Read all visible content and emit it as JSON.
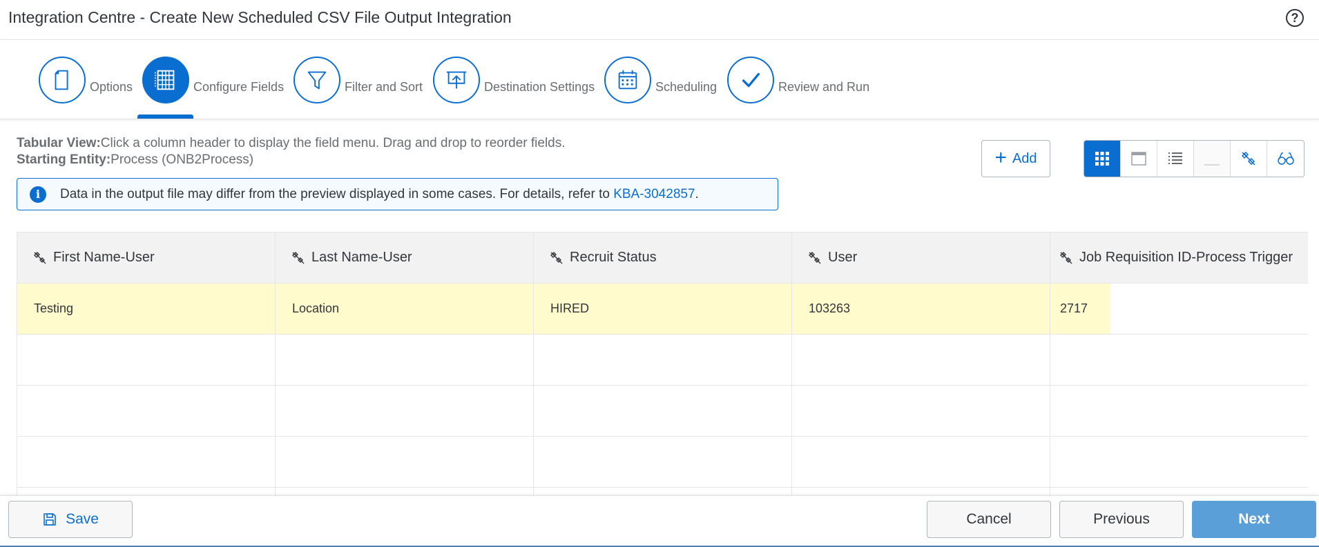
{
  "header": {
    "title": "Integration Centre - Create New Scheduled CSV File Output Integration",
    "help_icon": "question-circle-icon",
    "help_glyph": "?"
  },
  "wizard": {
    "steps": [
      {
        "label": "Options",
        "icon": "document-icon",
        "active": false
      },
      {
        "label": "Configure Fields",
        "icon": "table-grid-icon",
        "active": true
      },
      {
        "label": "Filter and Sort",
        "icon": "filter-icon",
        "active": false
      },
      {
        "label": "Destination Settings",
        "icon": "upload-presentation-icon",
        "active": false
      },
      {
        "label": "Scheduling",
        "icon": "calendar-icon",
        "active": false
      },
      {
        "label": "Review and Run",
        "icon": "checkmark-icon",
        "active": false
      }
    ]
  },
  "info": {
    "tabular_label": "Tabular View:",
    "tabular_text": "Click a column header to display the field menu. Drag and drop to reorder fields.",
    "entity_label": "Starting Entity:",
    "entity_text": "Process (ONB2Process)"
  },
  "message": {
    "icon": "info-icon",
    "text": "Data in the output file may differ from the preview displayed in some cases. For details, refer to ",
    "link": "KBA-3042857",
    "suffix": "."
  },
  "toolbar": {
    "add_label": "Add",
    "view_buttons": [
      {
        "icon": "grid-view-icon",
        "selected": true
      },
      {
        "icon": "window-view-icon",
        "selected": false
      },
      {
        "icon": "list-view-icon",
        "selected": false
      },
      {
        "icon": "minus-icon",
        "selected": false,
        "disabled": true
      },
      {
        "icon": "unlink-icon",
        "selected": false
      },
      {
        "icon": "glasses-icon",
        "selected": false
      }
    ]
  },
  "table": {
    "columns": [
      "First Name-User",
      "Last Name-User",
      "Recruit Status",
      "User",
      "Job Requisition ID-Process Trigger"
    ],
    "rows": [
      [
        "Testing",
        "Location",
        "HIRED",
        "103263",
        "2717"
      ],
      [
        "",
        "",
        "",
        "",
        ""
      ],
      [
        "",
        "",
        "",
        "",
        ""
      ],
      [
        "",
        "",
        "",
        "",
        ""
      ],
      [
        "",
        "",
        "",
        "",
        ""
      ]
    ]
  },
  "footer": {
    "save_label": "Save",
    "cancel_label": "Cancel",
    "previous_label": "Previous",
    "next_label": "Next"
  },
  "colors": {
    "accent": "#0a6ed1",
    "highlight_row": "#fffbcc",
    "next_button": "#5b9fd8"
  }
}
